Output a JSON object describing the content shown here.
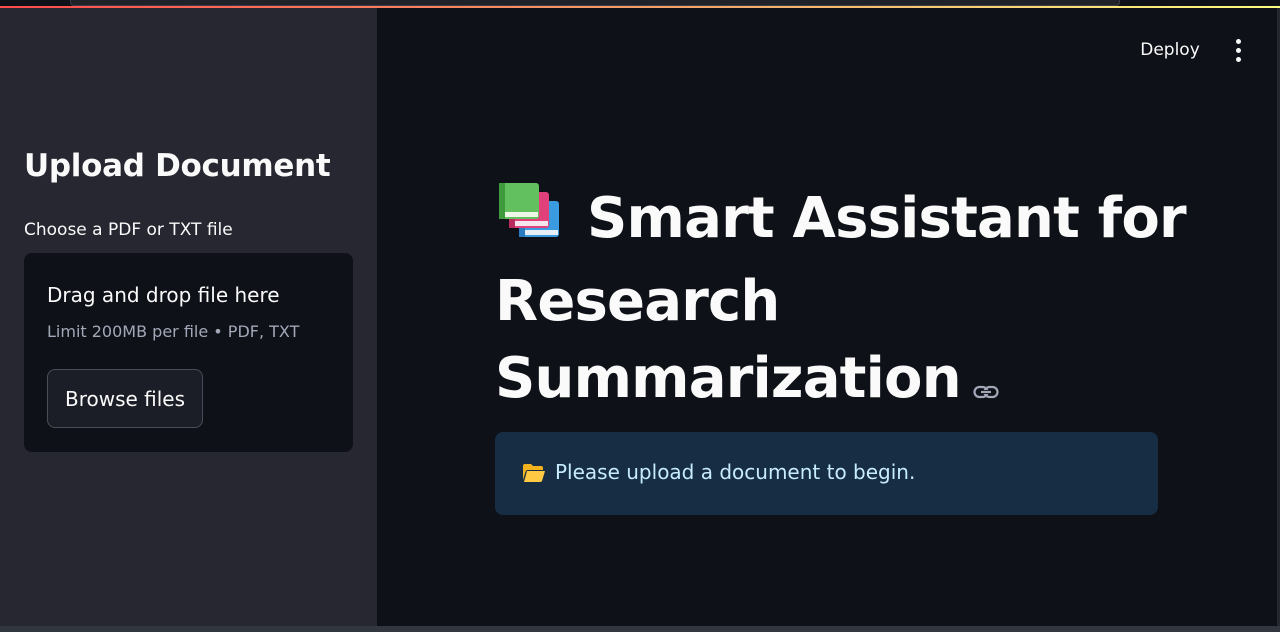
{
  "header": {
    "deploy_label": "Deploy",
    "menu_icon": "three-dots-vertical-icon"
  },
  "sidebar": {
    "heading": "Upload Document",
    "uploader": {
      "label": "Choose a PDF or TXT file",
      "drop_title": "Drag and drop file here",
      "limit_text": "Limit 200MB per file • PDF, TXT",
      "browse_label": "Browse files"
    }
  },
  "main": {
    "title": {
      "icon": "books-icon",
      "line1": "Smart Assistant for",
      "line2": "Research",
      "line3": "Summarization",
      "anchor_icon": "link-icon"
    },
    "info": {
      "icon": "open-folder-icon",
      "text": "Please upload a document to begin."
    }
  },
  "colors": {
    "sidebar_bg": "#262730",
    "main_bg": "#0e1117",
    "info_bg": "#172d43",
    "info_text": "#c7ebff",
    "accent_gradient_start": "#ff4b4b",
    "accent_gradient_end": "#fffd80"
  }
}
